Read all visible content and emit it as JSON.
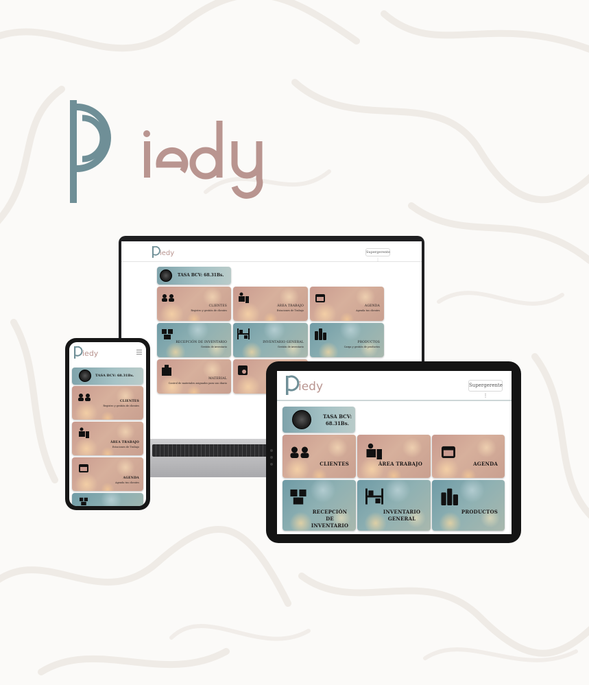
{
  "brand": {
    "logo_initial": "P",
    "logo_rest": "iedy",
    "teal": "#6f8f97",
    "rose": "#b99590"
  },
  "app": {
    "user_menu_label": "Supergerente",
    "rate_label": "TASA BCV: 68.31Bs.",
    "tiles": [
      {
        "title": "CLIENTES",
        "subtitle": "Registro y gestión de clientes",
        "icon": "clients-icon",
        "tone": "warm"
      },
      {
        "title": "ÁREA TRABAJO",
        "subtitle": "Estaciones de Trabajo",
        "icon": "workstation-icon",
        "tone": "warm"
      },
      {
        "title": "AGENDA",
        "subtitle": "Agenda tus clientes",
        "icon": "calendar-icon",
        "tone": "warm"
      },
      {
        "title": "RECEPCIÓN DE INVENTARIO",
        "subtitle": "Gestión de inventario",
        "icon": "boxes-icon",
        "tone": "cool"
      },
      {
        "title": "INVENTARIO GENERAL",
        "subtitle": "Gestión de inventario",
        "icon": "shelves-icon",
        "tone": "cool"
      },
      {
        "title": "PRODUCTOS",
        "subtitle": "Carga y gestión de productos",
        "icon": "bottles-icon",
        "tone": "cool"
      },
      {
        "title": "MATERIAL",
        "subtitle": "Control de materiales asignados para uso diario",
        "icon": "materials-icon",
        "tone": "warm"
      }
    ]
  }
}
